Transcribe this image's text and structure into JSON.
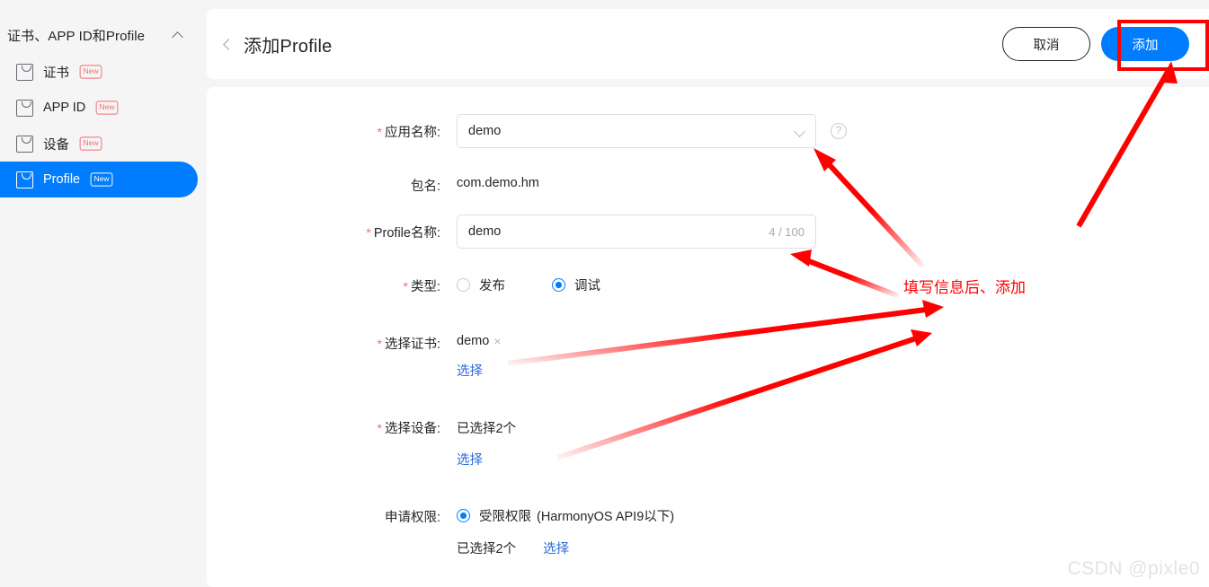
{
  "sidebar": {
    "header": {
      "title": "证书、APP ID和Profile",
      "collapse_icon": "chevron-up-icon"
    },
    "items": [
      {
        "label": "证书",
        "badge": "New",
        "icon": "bag-icon",
        "active": false
      },
      {
        "label": "APP ID",
        "badge": "New",
        "icon": "bag-icon",
        "active": false
      },
      {
        "label": "设备",
        "badge": "New",
        "icon": "bag-icon",
        "active": false
      },
      {
        "label": "Profile",
        "badge": "New",
        "icon": "bag-icon",
        "active": true
      }
    ]
  },
  "header": {
    "back_icon": "chevron-left-icon",
    "title": "添加Profile",
    "cancel_label": "取消",
    "add_label": "添加"
  },
  "form": {
    "app_name": {
      "label": "应用名称:",
      "required": true,
      "value": "demo",
      "caret_icon": "chevron-down-icon",
      "help_icon": "question-mark-icon",
      "help_glyph": "?"
    },
    "package_name": {
      "label": "包名:",
      "required": false,
      "value": "com.demo.hm"
    },
    "profile_name": {
      "label": "Profile名称:",
      "required": true,
      "value": "demo",
      "counter": "4 / 100"
    },
    "type": {
      "label": "类型:",
      "required": true,
      "options": [
        {
          "label": "发布",
          "checked": false
        },
        {
          "label": "调试",
          "checked": true
        }
      ]
    },
    "certificate": {
      "label": "选择证书:",
      "required": true,
      "tag": "demo",
      "tag_close": "×",
      "link": "选择"
    },
    "device": {
      "label": "选择设备:",
      "required": true,
      "count_text": "已选择2个",
      "link": "选择"
    },
    "permission": {
      "label": "申请权限:",
      "required": false,
      "option_label": "受限权限",
      "option_note": "(HarmonyOS API9以下)",
      "checked": true,
      "count_text": "已选择2个",
      "link": "选择"
    }
  },
  "annotations": {
    "note_text": "填写信息后、添加",
    "highlight_target": "add-button",
    "color": "#ff0000"
  },
  "watermark": {
    "text": "CSDN @pixle0"
  }
}
